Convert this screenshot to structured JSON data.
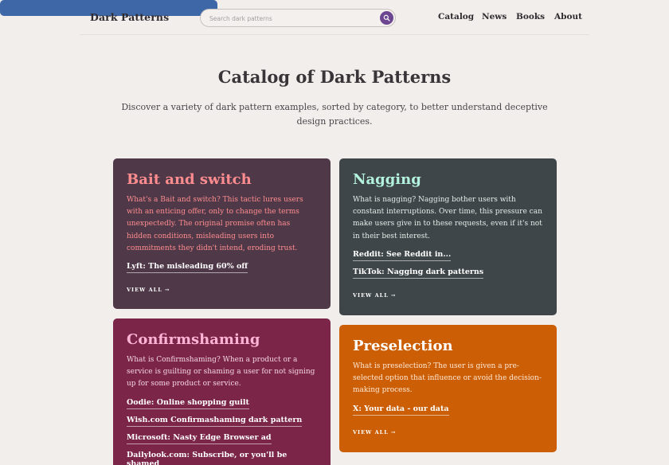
{
  "header": {
    "logo": "Dark Patterns",
    "search_placeholder": "Search dark patterns",
    "search_icon": "search-icon",
    "nav": [
      "Catalog",
      "News",
      "Books",
      "About"
    ]
  },
  "hero": {
    "title": "Catalog of Dark Patterns",
    "subtitle": "Discover a variety of dark pattern examples, sorted by category, to better understand deceptive design practices."
  },
  "cards": {
    "bait": {
      "title": "Bait and switch",
      "description": "What's a Bait and switch? This tactic lures users with an enticing offer, only to change the terms unexpectedly. The original promise often has hidden conditions, misleading users into commitments they didn't intend, eroding trust.",
      "links": [
        "Lyft: The misleading 60% off"
      ],
      "view_all": "VIEW ALL →",
      "color": "#4f3848"
    },
    "nagging": {
      "title": "Nagging",
      "description": "What is nagging? Nagging bother users with constant interruptions. Over time, this pressure can make users give in to these requests, even if it's not in their best interest.",
      "links": [
        "Reddit: See Reddit in...",
        "TikTok: Nagging dark patterns"
      ],
      "view_all": "VIEW ALL →",
      "color": "#3f4649"
    },
    "confirmshaming": {
      "title": "Confirmshaming",
      "description": "What is Confirmshaming? When a product or a service is guilting or shaming a user for not signing up for some product or service.",
      "links": [
        "Oodie: Online shopping guilt",
        "Wish.com Confirmashaming dark pattern",
        "Microsoft: Nasty Edge Browser ad",
        "Dailylook.com: Subscribe, or you'll be shamed"
      ],
      "color": "#7b2549"
    },
    "preselection": {
      "title": "Preselection",
      "description": "What is preselection? The user is given a pre-selected option that influence or avoid the decision-making process.",
      "links": [
        "X: Your data - our data"
      ],
      "view_all": "VIEW ALL →",
      "color": "#cc5f05"
    }
  }
}
